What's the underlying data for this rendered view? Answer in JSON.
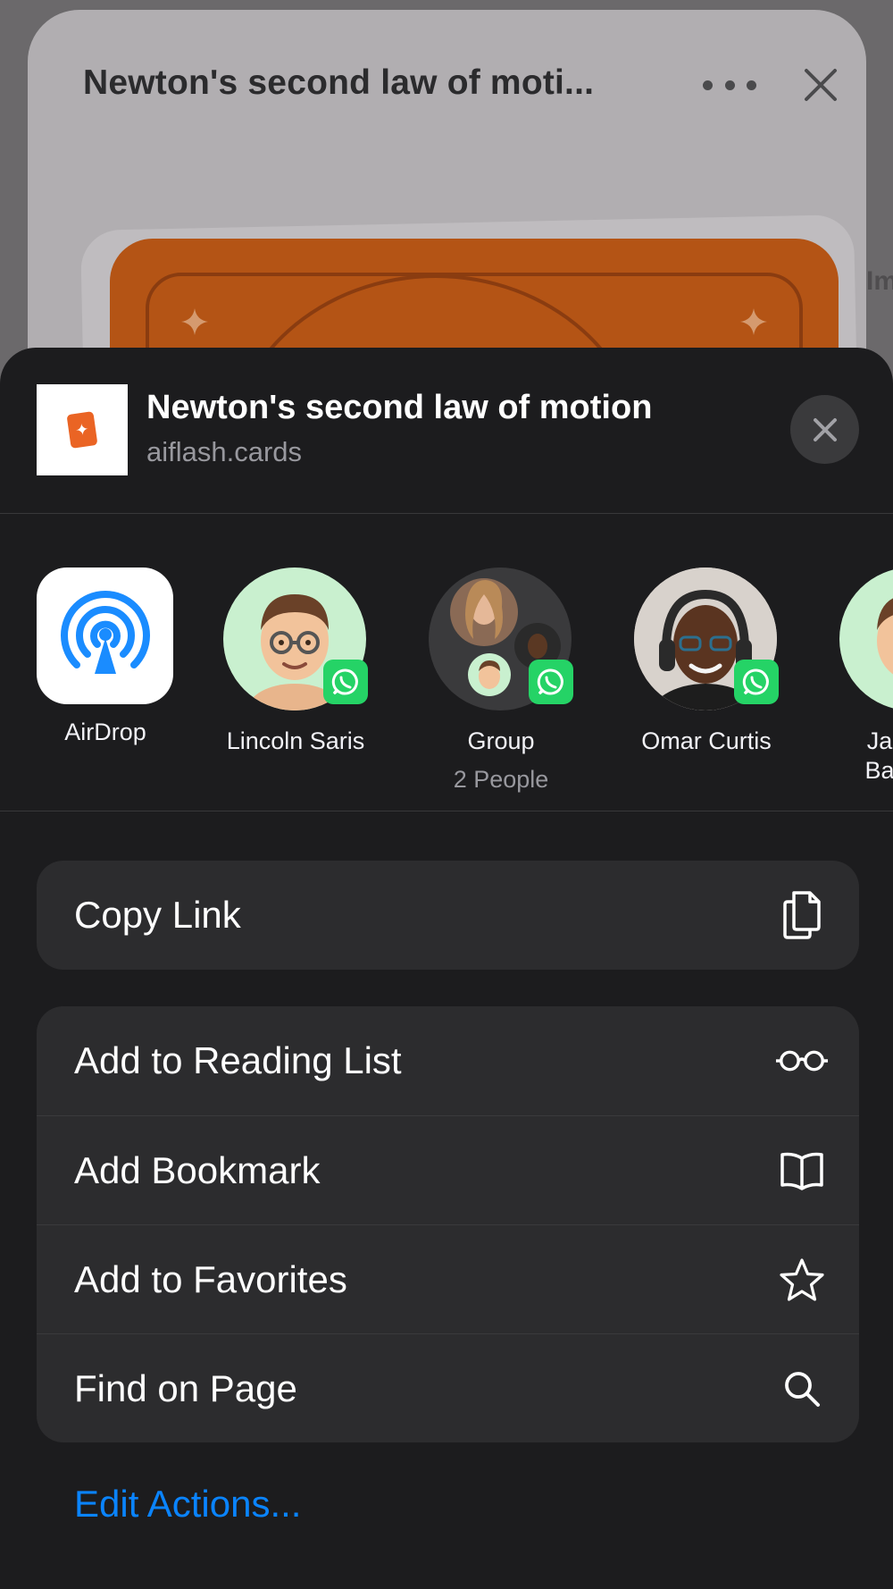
{
  "background_page": {
    "title": "Newton's second law of moti...",
    "side_text": "Im"
  },
  "share_sheet": {
    "title": "Newton's second law of motion",
    "subtitle": "aiflash.cards",
    "people": [
      {
        "label": "AirDrop",
        "sub": "",
        "icon": "airdrop-icon"
      },
      {
        "label": "Lincoln Saris",
        "sub": "",
        "icon": "whatsapp-icon"
      },
      {
        "label": "Group",
        "sub": "2 People",
        "icon": "whatsapp-icon"
      },
      {
        "label": "Omar Curtis",
        "sub": "",
        "icon": "whatsapp-icon"
      },
      {
        "label": "Ja\nBa",
        "sub": "",
        "icon": "whatsapp-icon"
      }
    ],
    "actions_primary": [
      {
        "label": "Copy Link",
        "icon": "copy-icon"
      }
    ],
    "actions_secondary": [
      {
        "label": "Add to Reading List",
        "icon": "glasses-icon"
      },
      {
        "label": "Add Bookmark",
        "icon": "book-icon"
      },
      {
        "label": "Add to Favorites",
        "icon": "star-icon"
      },
      {
        "label": "Find on Page",
        "icon": "search-icon"
      }
    ],
    "edit_actions": "Edit Actions..."
  },
  "colors": {
    "sheet_bg": "#1c1c1e",
    "group_bg": "#2c2c2e",
    "accent_blue": "#0a84ff",
    "whatsapp_green": "#25d366",
    "card_orange": "#b45415"
  }
}
